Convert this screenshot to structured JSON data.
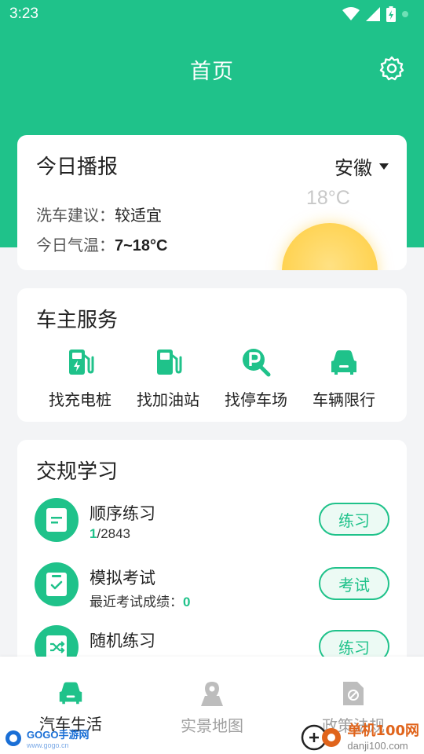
{
  "status_bar": {
    "time": "3:23",
    "icons": [
      "wifi-icon",
      "cell-signal-icon",
      "battery-charging-icon",
      "notification-dot-icon"
    ]
  },
  "header": {
    "title": "首页",
    "settings_icon": "gear-icon"
  },
  "today_card": {
    "title": "今日播报",
    "region": "安徽",
    "temperature_now": "18°C",
    "car_wash_label": "洗车建议：",
    "car_wash_value": "较适宜",
    "temp_label": "今日气温：",
    "temp_value": "7~18°C",
    "weather_icon": "sun-icon"
  },
  "service_card": {
    "title": "车主服务",
    "items": [
      {
        "label": "找充电桩",
        "icon": "charging-station-icon"
      },
      {
        "label": "找加油站",
        "icon": "gas-station-icon"
      },
      {
        "label": "找停车场",
        "icon": "parking-search-icon"
      },
      {
        "label": "车辆限行",
        "icon": "car-icon"
      }
    ]
  },
  "study_card": {
    "title": "交规学习",
    "rows": [
      {
        "name": "顺序练习",
        "progress_current": "1",
        "progress_total": "/2843",
        "button": "练习",
        "icon": "document-icon"
      },
      {
        "name": "模拟考试",
        "sub_label": "最近考试成绩：",
        "sub_value": "0",
        "button": "考试",
        "icon": "checklist-icon"
      },
      {
        "name": "随机练习",
        "button": "练习",
        "icon": "shuffle-icon"
      }
    ]
  },
  "bottom_nav": {
    "items": [
      {
        "label": "汽车生活",
        "icon": "car-icon",
        "active": true
      },
      {
        "label": "实景地图",
        "icon": "map-pin-icon",
        "active": false
      },
      {
        "label": "政策法规",
        "icon": "policy-document-icon",
        "active": false
      }
    ]
  },
  "watermarks": {
    "left_text": "GOGO手游网",
    "left_sub": "www.gogo.cn",
    "right_title": "单机100网",
    "right_url": "danji100.com"
  },
  "colors": {
    "brand_green": "#1fc28a",
    "background": "#f3f4f6",
    "sun": "#ffd24f"
  }
}
